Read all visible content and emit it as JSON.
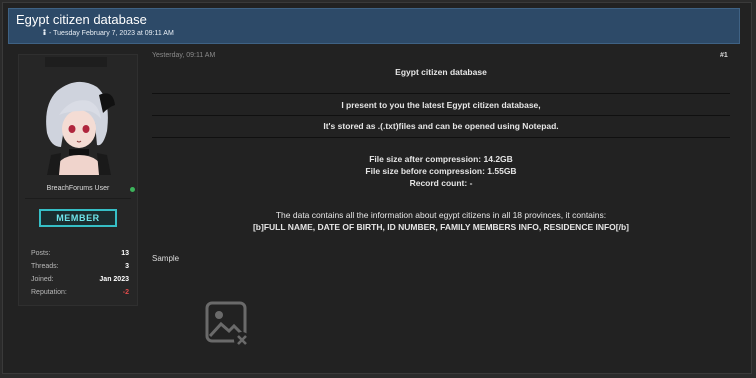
{
  "thread": {
    "title": "Egypt citizen database",
    "meta": "- Tuesday February 7, 2023 at 09:11 AM",
    "meta_icon": "person-icon"
  },
  "author": {
    "username": "BreachForums User",
    "role": "MEMBER",
    "online": true,
    "stats": [
      {
        "label": "Posts:",
        "value": "13"
      },
      {
        "label": "Threads:",
        "value": "3"
      },
      {
        "label": "Joined:",
        "value": "Jan 2023"
      },
      {
        "label": "Reputation:",
        "value": "-2"
      }
    ]
  },
  "post": {
    "date": "Yesterday, 09:11 AM",
    "number": "#1",
    "heading": "Egypt citizen database",
    "intro": "I present to you the latest Egypt citizen database,",
    "storage": "It's stored as .(.txt)files and can be opened using Notepad.",
    "size_after": "File size after compression:  14.2GB",
    "size_before": "File size before compression: 1.55GB",
    "record_count": "Record count: -",
    "contents_intro": "The data contains all the information about egypt citizens in all 18 provinces, it contains:",
    "contents_list": "[b]FULL NAME, DATE OF BIRTH, ID NUMBER, FAMILY MEMBERS INFO, RESIDENCE INFO[/b]",
    "sample_label": "Sample",
    "sample_image": "broken-image-icon"
  },
  "colors": {
    "header_bg": "#2d4a68",
    "badge": "#36bfc6",
    "online": "#3cb35b",
    "negative_rep": "#e04a4a"
  }
}
